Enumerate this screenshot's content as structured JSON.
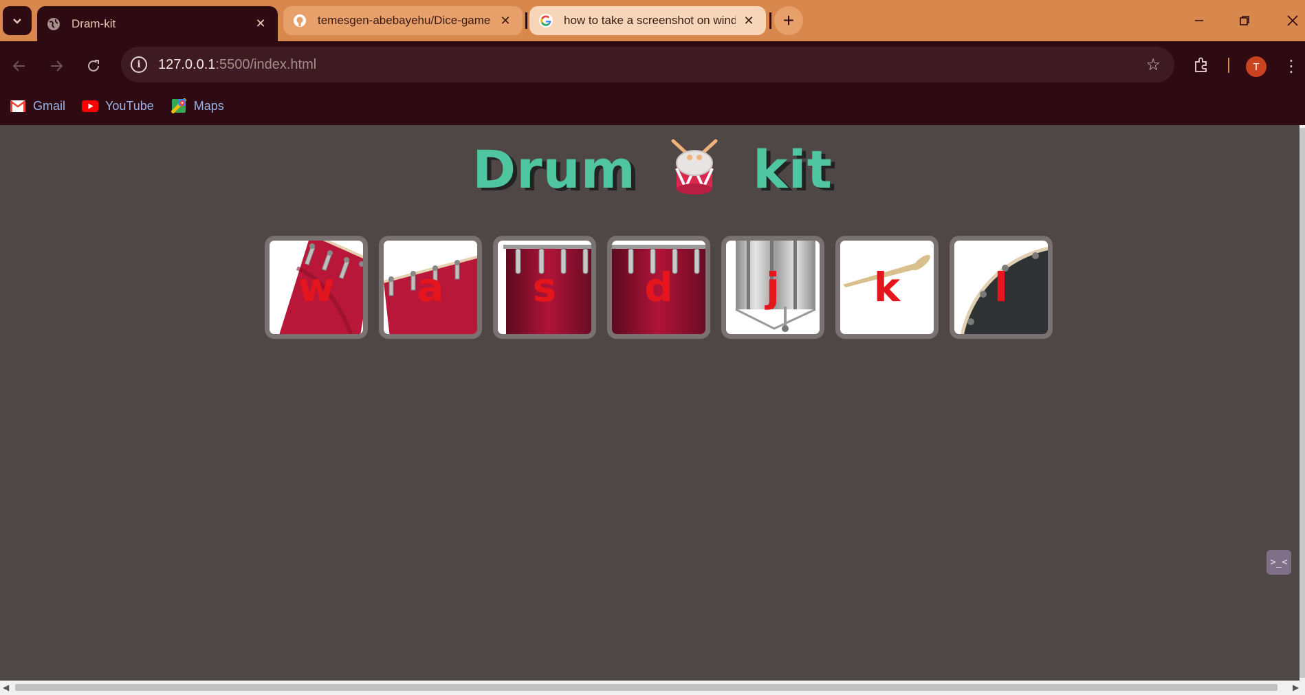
{
  "browser": {
    "tabs": [
      {
        "title": "Dram-kit",
        "icon": "globe-icon",
        "active": true
      },
      {
        "title": "temesgen-abebayehu/Dice-game",
        "icon": "github-icon",
        "active": false
      },
      {
        "title": "how to take a screenshot on windows",
        "icon": "google-icon",
        "active": false
      }
    ],
    "address": {
      "host": "127.0.0.1",
      "rest": ":5500/index.html"
    },
    "profile_initial": "T",
    "bookmarks": [
      {
        "label": "Gmail",
        "icon": "gmail-icon"
      },
      {
        "label": "YouTube",
        "icon": "youtube-icon"
      },
      {
        "label": "Maps",
        "icon": "maps-icon"
      }
    ],
    "colors": {
      "tab_strip": "#d9884d",
      "toolbar": "#2e0a13",
      "omnibox": "#3e1a22"
    }
  },
  "page": {
    "title_left": "Drum",
    "title_right": "kit",
    "title_icon": "drum-icon",
    "drums": [
      {
        "key": "w",
        "art": "tom-icon"
      },
      {
        "key": "a",
        "art": "tom-icon"
      },
      {
        "key": "s",
        "art": "bass-drum-icon"
      },
      {
        "key": "d",
        "art": "bass-drum-icon"
      },
      {
        "key": "j",
        "art": "snare-icon"
      },
      {
        "key": "k",
        "art": "drumstick-icon"
      },
      {
        "key": "l",
        "art": "cymbal-icon"
      }
    ],
    "colors": {
      "background": "#4f4646",
      "heading": "#4fc5a0",
      "key_letter": "#e4151c",
      "pad_border": "#7a7272"
    }
  },
  "devtools_toggle": ">_<"
}
